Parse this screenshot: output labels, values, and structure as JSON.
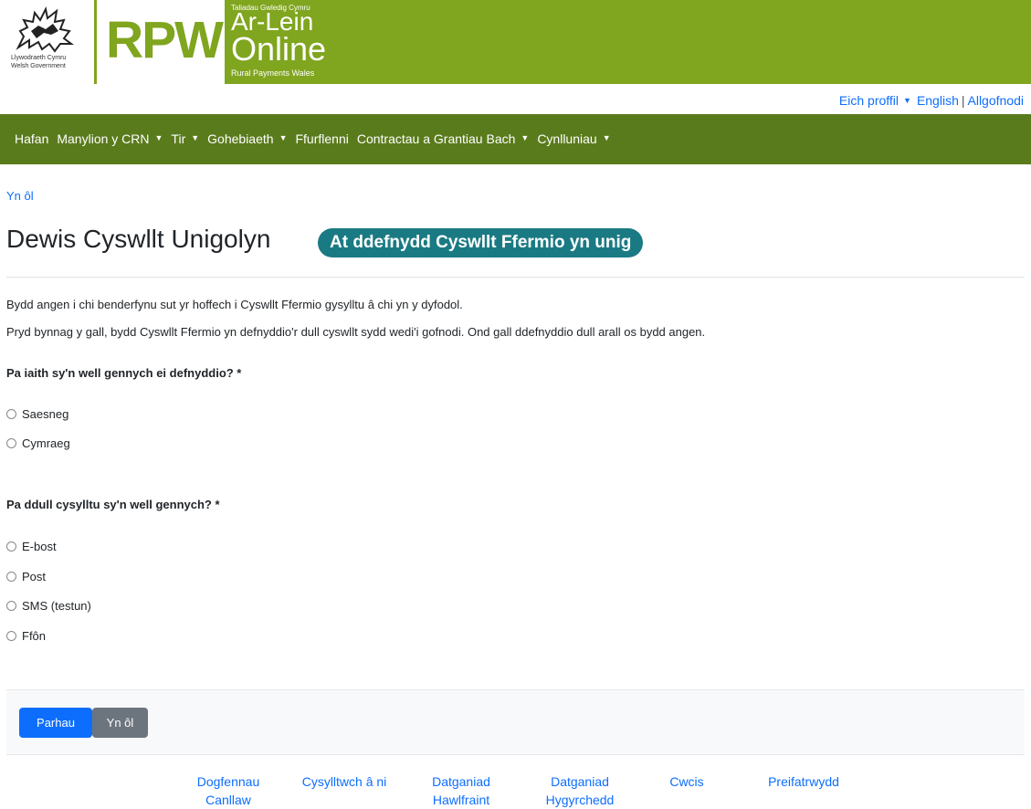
{
  "header": {
    "gov_name_line1": "Llywodraeth Cymru",
    "gov_name_line2": "Welsh Government",
    "logo_text": "RPW",
    "tagline_top": "Taliadau Gwledig Cymru",
    "online_line1": "Ar-Lein",
    "online_line2": "Online",
    "tagline_bottom": "Rural Payments Wales",
    "brand_color": "#80a51f"
  },
  "toplinks": {
    "profile": "Eich proffil",
    "language": "English",
    "separator": "|",
    "logout": "Allgofnodi"
  },
  "nav": {
    "items": [
      {
        "label": "Hafan",
        "dropdown": false
      },
      {
        "label": "Manylion y CRN",
        "dropdown": true
      },
      {
        "label": "Tir",
        "dropdown": true
      },
      {
        "label": "Gohebiaeth",
        "dropdown": true
      },
      {
        "label": "Ffurflenni",
        "dropdown": false
      },
      {
        "label": "Contractau a Grantiau Bach",
        "dropdown": true
      },
      {
        "label": "Cynlluniau",
        "dropdown": true
      }
    ],
    "color": "#5a7b1c"
  },
  "page": {
    "back_link": "Yn ôl",
    "title": "Dewis Cyswllt Unigolyn",
    "badge": "At ddefnydd Cyswllt Ffermio yn unig",
    "intro1": "Bydd angen i chi benderfynu sut yr hoffech i Cyswllt Ffermio gysylltu â chi yn y dyfodol.",
    "intro2": "Pryd bynnag y gall, bydd Cyswllt Ffermio yn defnyddio'r dull cyswllt sydd wedi'i gofnodi. Ond gall ddefnyddio dull arall os bydd angen."
  },
  "language_question": {
    "label": "Pa iaith sy'n well gennych ei defnyddio? *",
    "options": [
      "Saesneg",
      "Cymraeg"
    ]
  },
  "contact_question": {
    "label": "Pa ddull cysylltu sy'n well gennych? *",
    "options": [
      "E-bost",
      "Post",
      "SMS (testun)",
      "Ffôn"
    ]
  },
  "actions": {
    "continue": "Parhau",
    "back": "Yn ôl"
  },
  "footer": {
    "links": [
      {
        "line1": "Dogfennau",
        "line2": "Canllaw"
      },
      {
        "line1": "Cysylltwch â ni",
        "line2": ""
      },
      {
        "line1": "Datganiad",
        "line2": "Hawlfraint"
      },
      {
        "line1": "Datganiad",
        "line2": "Hygyrchedd"
      },
      {
        "line1": "Cwcis",
        "line2": ""
      },
      {
        "line1": "Preifatrwydd",
        "line2": ""
      }
    ]
  }
}
